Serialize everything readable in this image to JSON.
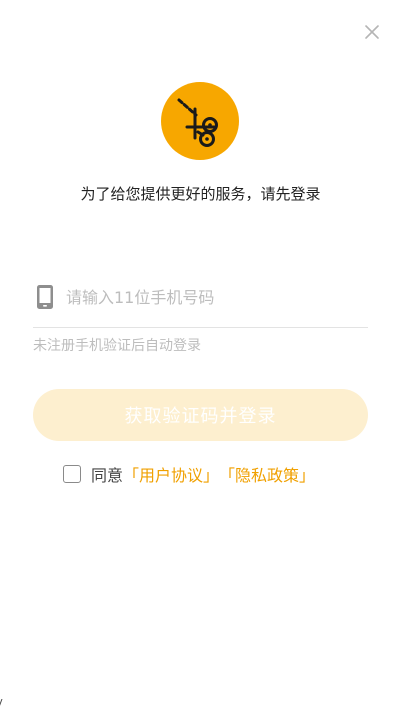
{
  "header": {
    "close_icon": "close-icon"
  },
  "logo": {
    "icon": "scissors-cut-icon",
    "color": "#f7a700"
  },
  "subtitle": "为了给您提供更好的服务，请先登录",
  "phone": {
    "icon": "mobile-phone-icon",
    "placeholder": "请输入11位手机号码",
    "value": ""
  },
  "hint": "未注册手机验证后自动登录",
  "submit_label": "获取验证码并登录",
  "agreement": {
    "checked": false,
    "prefix": "同意",
    "user_agreement": "「用户协议」",
    "privacy_policy": "「隐私政策」",
    "link_color": "#f0a000"
  }
}
